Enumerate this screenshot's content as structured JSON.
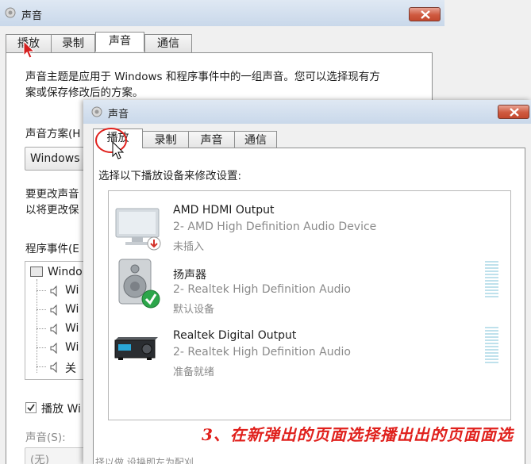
{
  "back_window": {
    "title": "声音",
    "tabs": [
      "播放",
      "录制",
      "声音",
      "通信"
    ],
    "active_tab": "声音",
    "intro": [
      "声音主题是应用于 Windows 和程序事件中的一组声音。您可以选择现有方",
      "案或保存修改后的方案。"
    ],
    "scheme_label": "声音方案(H",
    "scheme_value": "Windows",
    "change_text": [
      "要更改声音",
      "以将更改保"
    ],
    "program_events_label": "程序事件(E",
    "events_root": "Windo",
    "events": [
      "Wi",
      "Wi",
      "Wi",
      "Wi",
      "关"
    ],
    "checkbox_label": "播放 Wi",
    "sounds_label": "声音(S):",
    "sounds_value": "(无)"
  },
  "front_window": {
    "title": "声音",
    "tabs": [
      "播放",
      "录制",
      "声音",
      "通信"
    ],
    "active_tab": "播放",
    "instruction": "选择以下播放设备来修改设置:",
    "devices": [
      {
        "name": "AMD HDMI Output",
        "description": "2- AMD High Definition Audio Device",
        "status": "未插入",
        "icon": "monitor-icon"
      },
      {
        "name": "扬声器",
        "description": "2- Realtek High Definition Audio",
        "status": "默认设备",
        "icon": "speaker-icon"
      },
      {
        "name": "Realtek Digital Output",
        "description": "2- Realtek High Definition Audio",
        "status": "准备就绪",
        "icon": "digital-receiver-icon"
      }
    ],
    "bottom_partial": "择以做 设操即左为配刈"
  },
  "caption": "3、在新弹出的页面选择播出出的页面面选",
  "colors": {
    "accent_red": "#e0201c",
    "window_bg": "#f0f0f0",
    "titlebar": "#c9d8ea"
  }
}
